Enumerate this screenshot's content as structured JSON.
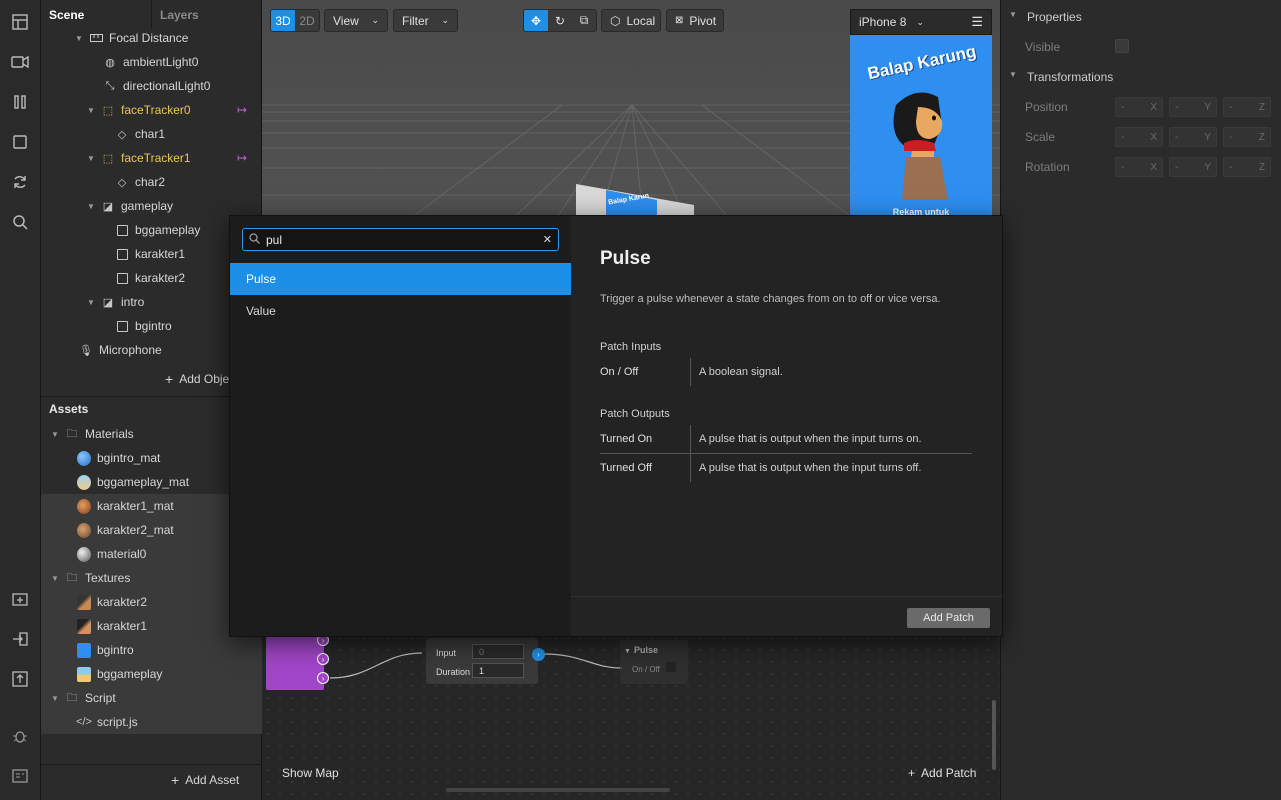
{
  "left_panel": {
    "tabs": [
      "Scene",
      "Layers"
    ],
    "scene_items": [
      {
        "label": "Focal Distance",
        "icon": "ruler-icon"
      },
      {
        "label": "ambientLight0",
        "icon": "globe-icon"
      },
      {
        "label": "directionalLight0",
        "icon": "directional-light-icon"
      },
      {
        "label": "faceTracker0",
        "icon": "face-tracker-icon"
      },
      {
        "label": "char1",
        "icon": "plane-icon"
      },
      {
        "label": "faceTracker1",
        "icon": "face-tracker-icon"
      },
      {
        "label": "char2",
        "icon": "plane-icon"
      },
      {
        "label": "gameplay",
        "icon": "canvas-icon"
      },
      {
        "label": "bggameplay",
        "icon": "rectangle-icon"
      },
      {
        "label": "karakter1",
        "icon": "rectangle-icon"
      },
      {
        "label": "karakter2",
        "icon": "rectangle-icon"
      },
      {
        "label": "intro",
        "icon": "canvas-icon"
      },
      {
        "label": "bgintro",
        "icon": "rectangle-icon"
      },
      {
        "label": "Microphone",
        "icon": "microphone-icon"
      }
    ],
    "add_object_label": "Add Obje",
    "assets_title": "Assets",
    "assets": [
      {
        "label": "Materials",
        "icon": "folder-icon"
      },
      {
        "label": "bgintro_mat",
        "icon": "material-icon"
      },
      {
        "label": "bggameplay_mat",
        "icon": "material-icon"
      },
      {
        "label": "karakter1_mat",
        "icon": "material-icon"
      },
      {
        "label": "karakter2_mat",
        "icon": "material-icon"
      },
      {
        "label": "material0",
        "icon": "material-icon"
      },
      {
        "label": "Textures",
        "icon": "folder-icon"
      },
      {
        "label": "karakter2",
        "icon": "texture-icon"
      },
      {
        "label": "karakter1",
        "icon": "texture-icon"
      },
      {
        "label": "bgintro",
        "icon": "texture-icon"
      },
      {
        "label": "bggameplay",
        "icon": "texture-icon"
      },
      {
        "label": "Script",
        "icon": "folder-icon"
      },
      {
        "label": "script.js",
        "icon": "code-icon"
      }
    ],
    "add_asset_label": "Add Asset"
  },
  "viewport": {
    "mode_3d": "3D",
    "mode_2d": "2D",
    "view_label": "View",
    "filter_label": "Filter",
    "local_label": "Local",
    "pivot_label": "Pivot",
    "device_label": "iPhone 8",
    "preview_title": "Balap Karung",
    "preview_caption": "Rekam untuk",
    "small_preview_text": "Balap Karun"
  },
  "patch_editor": {
    "show_map": "Show Map",
    "add_patch": "Add Patch",
    "node1": {
      "input_label": "Input",
      "input_value": "0",
      "duration_label": "Duration",
      "duration_value": "1"
    },
    "node2": {
      "title": "Pulse",
      "port_label": "On / Off"
    }
  },
  "properties": {
    "title": "Properties",
    "visible_label": "Visible",
    "transformations_title": "Transformations",
    "rows": [
      {
        "label": "Position"
      },
      {
        "label": "Scale"
      },
      {
        "label": "Rotation"
      }
    ],
    "axes": [
      "X",
      "Y",
      "Z"
    ],
    "placeholder": "-"
  },
  "dialog": {
    "search_value": "pul",
    "results": [
      "Pulse",
      "Value"
    ],
    "detail_title": "Pulse",
    "detail_desc": "Trigger a pulse whenever a state changes from on to off or vice versa.",
    "inputs_heading": "Patch Inputs",
    "inputs": [
      {
        "name": "On / Off",
        "desc": "A boolean signal."
      }
    ],
    "outputs_heading": "Patch Outputs",
    "outputs": [
      {
        "name": "Turned On",
        "desc": "A pulse that is output when the input turns on."
      },
      {
        "name": "Turned Off",
        "desc": "A pulse that is output when the input turns off."
      }
    ],
    "add_patch_button": "Add Patch"
  },
  "colors": {
    "accent": "#1e8fe6",
    "face_tracker": "#e8c84a",
    "link_arrow": "#c064d8",
    "preview_bg": "#2e8ff0",
    "patch_node_purple": "#a046c8"
  }
}
